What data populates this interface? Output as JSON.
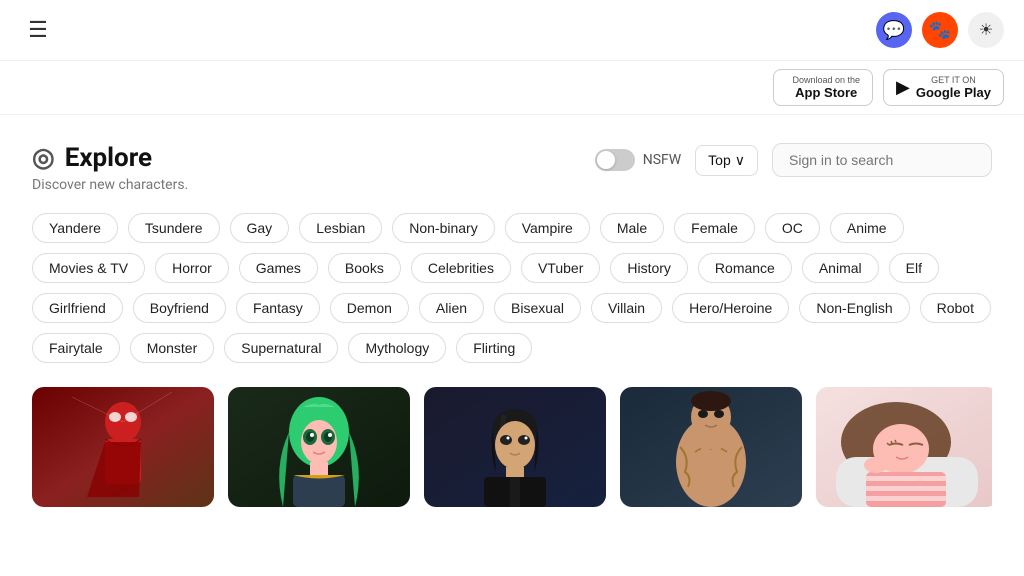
{
  "header": {
    "discord_label": "Discord",
    "reddit_label": "Reddit",
    "theme_icon": "☀"
  },
  "store": {
    "appstore_prefix": "Download on the",
    "appstore_name": "App Store",
    "appstore_icon": "",
    "googleplay_prefix": "GET IT ON",
    "googleplay_name": "Google Play",
    "googleplay_icon": "▶"
  },
  "explore": {
    "icon": "◎",
    "title": "Explore",
    "subtitle": "Discover new characters.",
    "nsfw_label": "NSFW",
    "sort_label": "Top",
    "sort_icon": "∨",
    "search_placeholder": "Sign in to search"
  },
  "tags": [
    "Yandere",
    "Tsundere",
    "Gay",
    "Lesbian",
    "Non-binary",
    "Vampire",
    "Male",
    "Female",
    "OC",
    "Anime",
    "Movies & TV",
    "Horror",
    "Games",
    "Books",
    "Celebrities",
    "VTuber",
    "History",
    "Romance",
    "Animal",
    "Elf",
    "Girlfriend",
    "Boyfriend",
    "Fantasy",
    "Demon",
    "Alien",
    "Bisexual",
    "Villain",
    "Hero/Heroine",
    "Non-English",
    "Robot",
    "Fairytale",
    "Monster",
    "Supernatural",
    "Mythology",
    "Flirting"
  ],
  "cards": [
    {
      "id": 1,
      "style": "card-1",
      "emoji": "🦸"
    },
    {
      "id": 2,
      "style": "card-2",
      "emoji": "🧝"
    },
    {
      "id": 3,
      "style": "card-3",
      "emoji": "🧑"
    },
    {
      "id": 4,
      "style": "card-4",
      "emoji": "💪"
    },
    {
      "id": 5,
      "style": "card-5",
      "emoji": "😴"
    }
  ]
}
